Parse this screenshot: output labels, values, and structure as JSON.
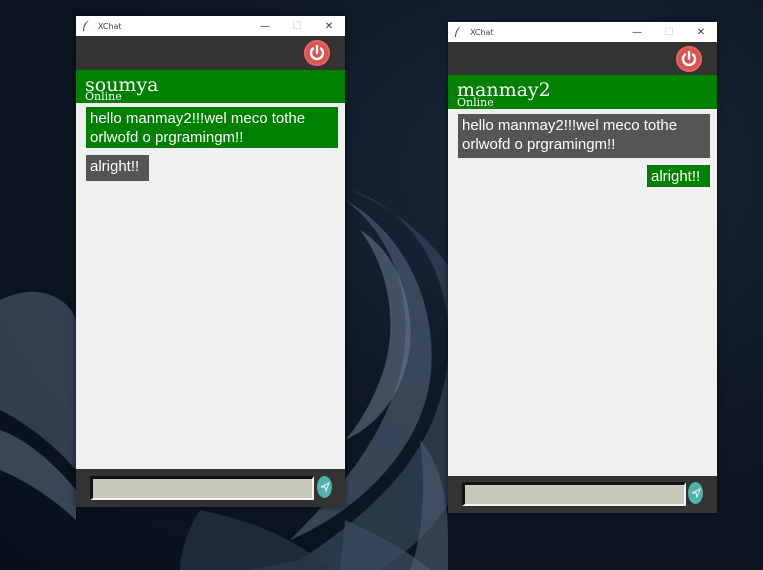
{
  "windows": [
    {
      "title": "XChat",
      "contact": {
        "name": "soumya",
        "status": "Online"
      },
      "messages": [
        {
          "text": "hello manmay2!!!wel meco  tothe orlwofd o prgramingm!!",
          "style": "sent"
        },
        {
          "text": "alright!!",
          "style": "received"
        }
      ],
      "input": {
        "value": ""
      }
    },
    {
      "title": "XChat",
      "contact": {
        "name": "manmay2",
        "status": "Online"
      },
      "messages": [
        {
          "text": "hello manmay2!!!wel meco  tothe orlwofd o prgramingm!!",
          "style": "received"
        },
        {
          "text": "alright!!",
          "style": "sent"
        }
      ],
      "input": {
        "value": ""
      }
    }
  ],
  "title_controls": {
    "minimize": "—",
    "maximize": "☐",
    "close": "✕"
  },
  "icons": {
    "app": "feather-icon",
    "power": "power-icon",
    "send": "send-icon"
  },
  "colors": {
    "header": "#008000",
    "sent_bubble": "#008000",
    "received_bubble": "#555555",
    "topbar": "#333333",
    "power": "#d9534f",
    "send": "#4fb3a9"
  }
}
